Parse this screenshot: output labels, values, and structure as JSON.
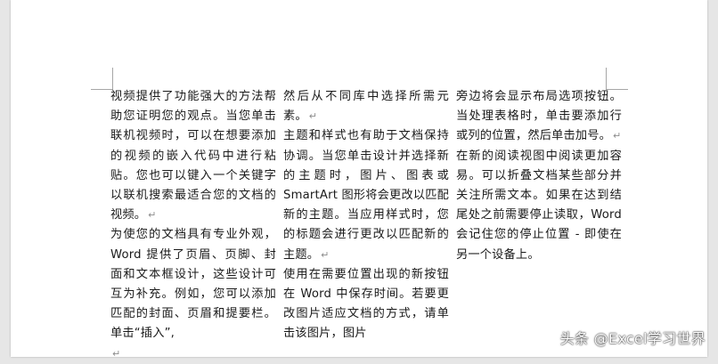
{
  "document": {
    "columns": [
      {
        "paragraphs": [
          "视频提供了功能强大的方法帮助您证明您的观点。当您单击联机视频时，可以在想要添加的视频的嵌入代码中进行粘贴。您也可以键入一个关键字以联机搜索最适合您的文档的视频。",
          "为使您的文档具有专业外观，Word 提供了页眉、页脚、封面和文本框设计，这些设计可互为补充。例如，您可以添加匹配的封面、页眉和提要栏。单击“插入”,",
          ""
        ]
      },
      {
        "paragraphs": [
          "然后从不同库中选择所需元素。",
          "主题和样式也有助于文档保持协调。当您单击设计并选择新的主题时，图片、图表或 SmartArt 图形将会更改以匹配新的主题。当应用样式时，您的标题会进行更改以匹配新的主题。",
          "使用在需要位置出现的新按钮在 Word 中保存时间。若要更改图片适应文档的方式，请单击该图片，图片"
        ]
      },
      {
        "paragraphs": [
          "旁边将会显示布局选项按钮。当处理表格时，单击要添加行或列的位置，然后单击加号。",
          "在新的阅读视图中阅读更加容易。可以折叠文档某些部分并关注所需文本。如果在达到结尾处之前需要停止读取，Word 会记住您的停止位置 - 即使在另一个设备上。"
        ]
      }
    ],
    "paragraph_mark": "↵"
  },
  "watermark": {
    "text": "头条 @Excel学习世界"
  },
  "colors": {
    "page": "#ffffff",
    "background": "#e6e6e6",
    "text": "#1a1a1a",
    "paragraph_mark": "#8c8c8c"
  }
}
